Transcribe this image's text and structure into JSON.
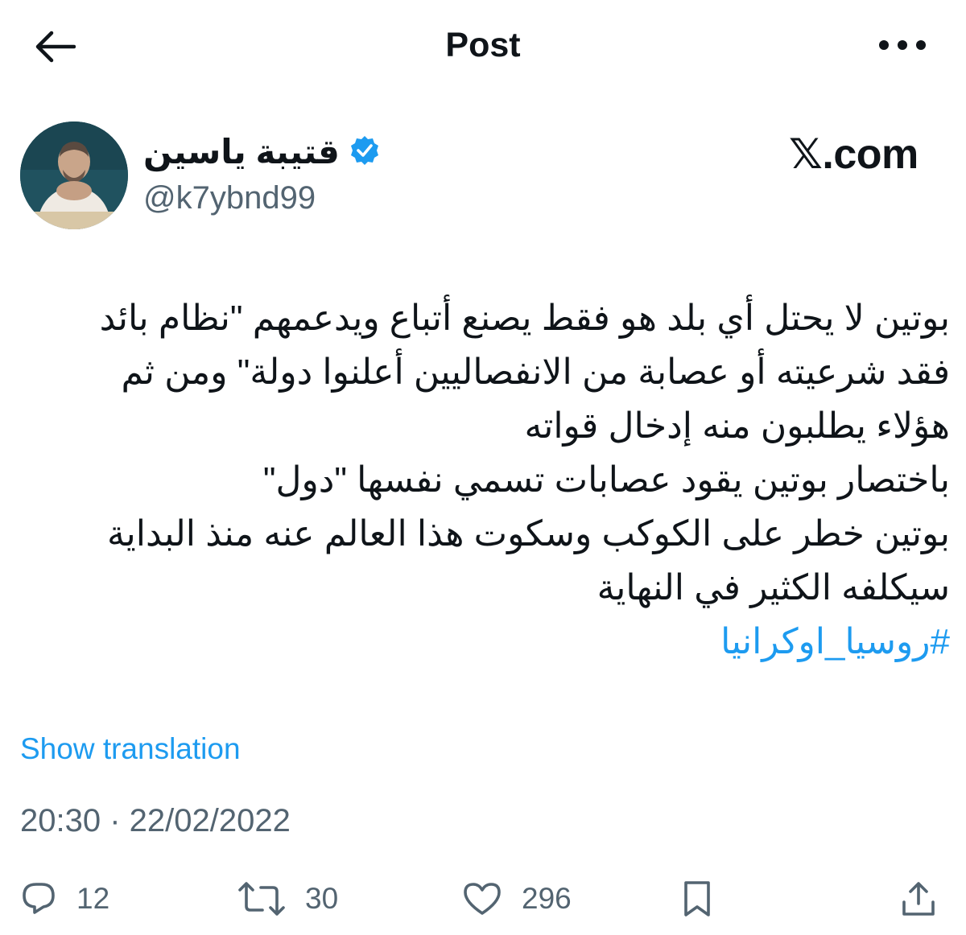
{
  "header": {
    "title": "Post",
    "back_icon": "arrow-left-icon",
    "more_icon": "more-horizontal-icon"
  },
  "author": {
    "display_name": "قتيبة ياسين",
    "handle": "@k7ybnd99",
    "verified": true,
    "verified_color": "#1d9bf0"
  },
  "watermark": "𝕏.com",
  "tweet": {
    "lines": [
      "بوتين لا يحتل أي بلد هو فقط يصنع أتباع ويدعمهم \"نظام بائد",
      "فقد شرعيته أو عصابة من الانفصاليين أعلنوا دولة\" ومن ثم",
      "هؤلاء يطلبون منه إدخال قواته",
      "باختصار بوتين يقود عصابات تسمي نفسها \"دول\"",
      "بوتين خطر على الكوكب وسكوت هذا العالم عنه منذ البداية",
      "سيكلفه الكثير في النهاية"
    ],
    "hashtag": "#روسيا_اوكرانيا",
    "show_translation": "Show translation",
    "timestamp": "20:30 · 22/02/2022"
  },
  "actions": {
    "replies": "12",
    "reposts": "30",
    "likes": "296"
  },
  "colors": {
    "accent": "#1d9bf0",
    "text": "#0f1419",
    "muted": "#536471"
  }
}
